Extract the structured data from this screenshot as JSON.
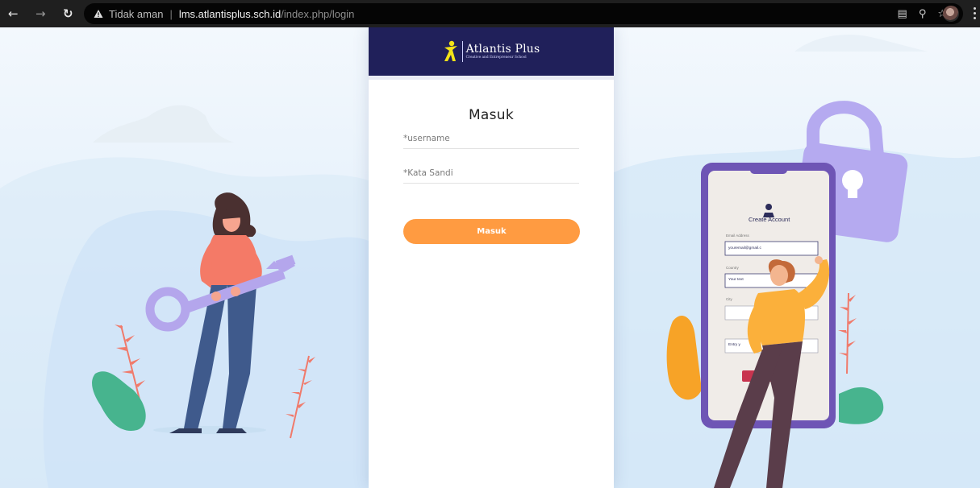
{
  "browser": {
    "security_warning": "Tidak aman",
    "url_host": "lms.atlantisplus.sch.id",
    "url_path": "/index.php/login"
  },
  "brand": {
    "title": "Atlantis Plus",
    "subtitle": "Creative and Entrepreneur School",
    "header_color": "#20205a"
  },
  "login": {
    "title": "Masuk",
    "username_placeholder": "*username",
    "password_placeholder": "*Kata Sandi",
    "submit_label": "Masuk",
    "accent_color": "#ff9b41"
  },
  "illustration": {
    "phone_heading": "Create Account",
    "phone_label_email": "Email Address",
    "phone_email_value": "youremail@gmail.c",
    "phone_label_country": "Country",
    "phone_country_value": "Your text",
    "phone_label_city": "City",
    "phone_input_partial": "Entry y"
  }
}
